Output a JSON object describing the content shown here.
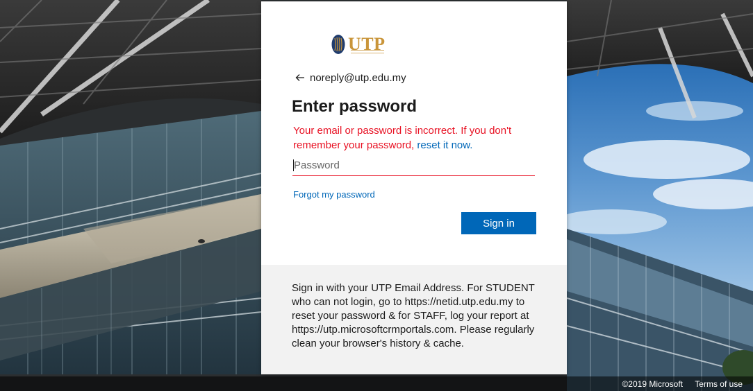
{
  "brand": {
    "logo_text": "UTP",
    "logo_gold": "#c9953a",
    "logo_navy": "#1f3c6e"
  },
  "identity": {
    "back_icon": "arrow-left-icon",
    "email": "noreply@utp.edu.my"
  },
  "page_title": "Enter password",
  "error": {
    "message": "Your email or password is incorrect. If you don't remember your password,",
    "link_text": "reset it now.",
    "color": "#e81123"
  },
  "password_field": {
    "placeholder": "Password",
    "value": ""
  },
  "forgot_link": "Forgot my password",
  "signin_button": "Sign in",
  "accent_color": "#0067b8",
  "footer_note": "Sign in with your UTP Email Address. For STUDENT who can not login, go to https://netid.utp.edu.my to reset your password & for STAFF, log your report at https://utp.microsoftcrmportals.com. Please regularly clean your browser's history & cache.",
  "page_footer": {
    "copyright": "©2019 Microsoft",
    "terms": "Terms of use"
  }
}
